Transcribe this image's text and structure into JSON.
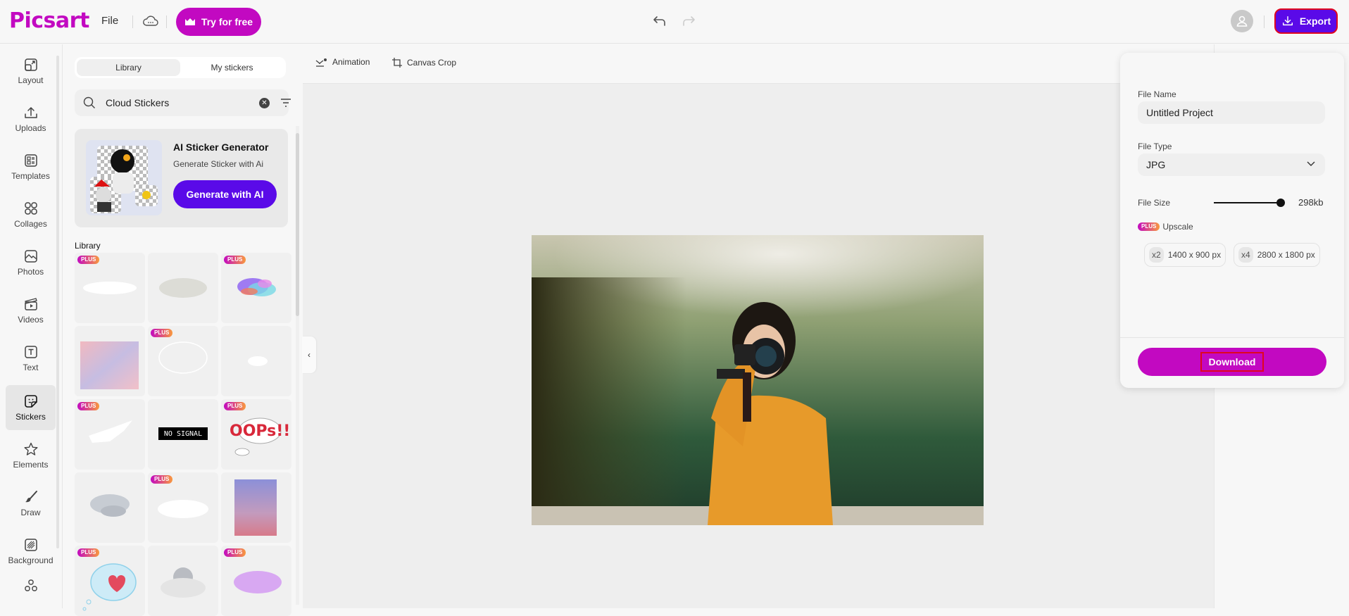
{
  "app": {
    "logo": "Picsart",
    "file_menu": "File",
    "cloud_icon": "cloud-saving-icon",
    "try_button": "Try for free",
    "export_button": "Export"
  },
  "colors": {
    "brand": "#c209c1",
    "accent": "#5a0ae8",
    "highlight_border": "#e0061f"
  },
  "leftnav": {
    "items": [
      {
        "label": "Layout",
        "icon": "layout-icon"
      },
      {
        "label": "Uploads",
        "icon": "upload-icon"
      },
      {
        "label": "Templates",
        "icon": "templates-icon"
      },
      {
        "label": "Collages",
        "icon": "collages-icon"
      },
      {
        "label": "Photos",
        "icon": "photo-icon"
      },
      {
        "label": "Videos",
        "icon": "video-icon"
      },
      {
        "label": "Text",
        "icon": "text-icon"
      },
      {
        "label": "Stickers",
        "icon": "sticker-icon",
        "active": true
      },
      {
        "label": "Elements",
        "icon": "star-icon"
      },
      {
        "label": "Draw",
        "icon": "brush-icon"
      },
      {
        "label": "Background",
        "icon": "background-icon"
      },
      {
        "label": "",
        "icon": "more-apps-icon"
      }
    ]
  },
  "stickers": {
    "tabs": [
      "Library",
      "My stickers"
    ],
    "active_tab": "Library",
    "search_value": "Cloud Stickers",
    "ai_card": {
      "title": "AI Sticker Generator",
      "subtitle": "Generate Sticker with Ai",
      "button": "Generate with AI"
    },
    "library_label": "Library",
    "plus_badge": "PLUS",
    "no_signal_text": "NO SIGNAL",
    "items": [
      {
        "name": "white-cloud",
        "plus": true
      },
      {
        "name": "grey-cloud",
        "plus": false
      },
      {
        "name": "colorful-cloud",
        "plus": true
      },
      {
        "name": "pink-sky",
        "plus": false
      },
      {
        "name": "outline-cloud",
        "plus": true
      },
      {
        "name": "faint-cloud",
        "plus": false
      },
      {
        "name": "airplane-cloud",
        "plus": true
      },
      {
        "name": "no-signal",
        "plus": false
      },
      {
        "name": "oops-cloud",
        "plus": true
      },
      {
        "name": "storm-cloud",
        "plus": false
      },
      {
        "name": "soft-cloud",
        "plus": true
      },
      {
        "name": "sunset-sky",
        "plus": false
      },
      {
        "name": "heart-thought-cloud",
        "plus": true
      },
      {
        "name": "moon-cloud",
        "plus": false
      },
      {
        "name": "purple-cloud",
        "plus": true
      }
    ]
  },
  "canvas_toolbar": {
    "animation": "Animation",
    "canvas_crop": "Canvas Crop"
  },
  "export_panel": {
    "file_name_label": "File Name",
    "file_name_value": "Untitled Project",
    "file_type_label": "File Type",
    "file_type_value": "JPG",
    "file_size_label": "File Size",
    "file_size_value": "298kb",
    "file_size_slider_fraction": 1.0,
    "plus_badge": "PLUS",
    "upscale_label": "Upscale",
    "upscale_options": [
      {
        "mult": "x2",
        "size": "1400 x 900 px"
      },
      {
        "mult": "x4",
        "size": "2800 x 1800 px"
      }
    ],
    "download_button": "Download"
  }
}
